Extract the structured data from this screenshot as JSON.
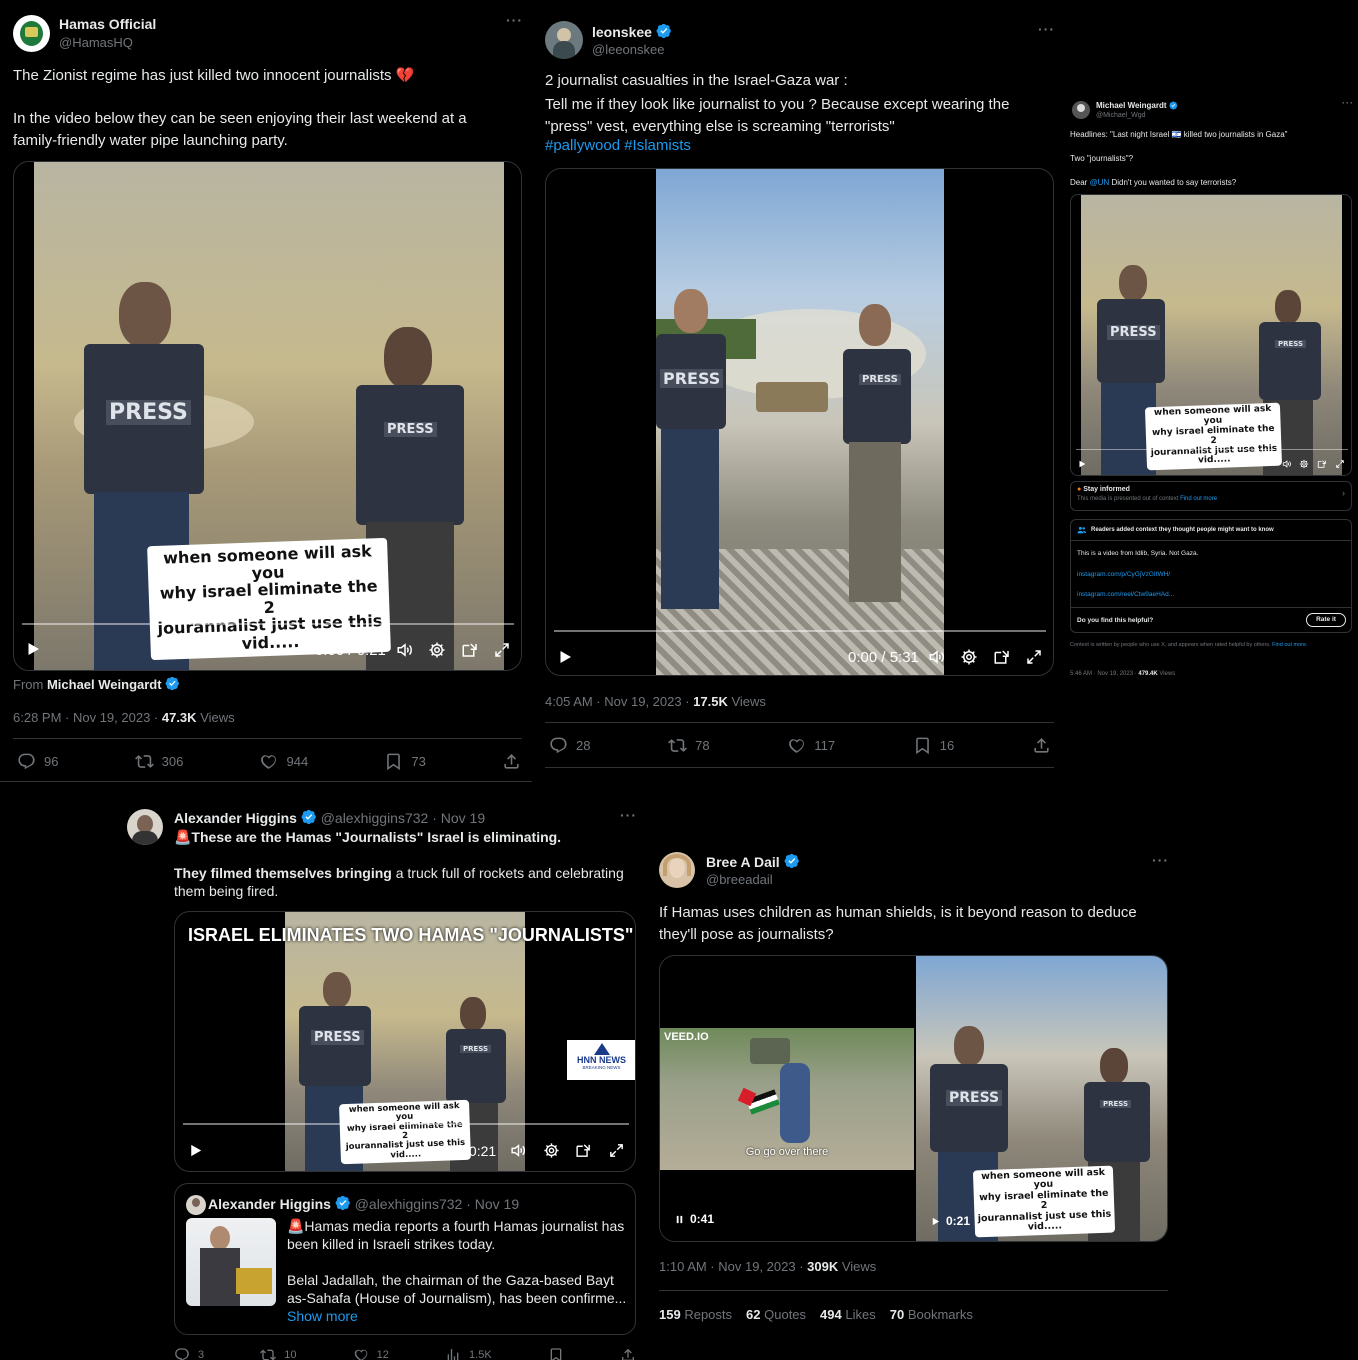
{
  "tweet1": {
    "name": "Hamas Official",
    "handle": "@HamasHQ",
    "text_line1": "The Zionist regime has just killed two innocent journalists 💔",
    "text_line2": "In the video below they can be seen enjoying their last weekend at a family-friendly water pipe launching party.",
    "video_time": "0:00 / 0:21",
    "from_label": "From",
    "from_name": "Michael Weingardt",
    "timestamp": "6:28 PM · Nov 19, 2023 · ",
    "views_count": "47.3K",
    "views_label": "Views",
    "replies": "96",
    "reposts": "306",
    "likes": "944",
    "bookmarks": "73"
  },
  "tweet2": {
    "name": "leonskee",
    "handle": "@leeonskee",
    "text_line1": "2 journalist casualties in the Israel-Gaza war :",
    "text_line2": "Tell me if they look like journalist to you ? Because except wearing the \"press\" vest, everything else is screaming \"terrorists\"",
    "hashtags": "#pallywood #Islamists",
    "video_time": "0:00 / 5:31",
    "timestamp": "4:05 AM · Nov 19, 2023 · ",
    "views_count": "17.5K",
    "views_label": "Views",
    "replies": "28",
    "reposts": "78",
    "likes": "117",
    "bookmarks": "16"
  },
  "tweet3": {
    "name": "Michael Weingardt",
    "handle": "@Michael_Wgd",
    "line1": "Headlines: \"Last night Israel 🇮🇱 killed two journalists in Gaza\"",
    "line2": "Two \"journalists\"?",
    "line3_pre": "Dear ",
    "line3_mention": "@UN",
    "line3_post": " Didn't you wanted to say terrorists?",
    "video_time": "0:01 / 0:21",
    "stay_title": "Stay informed",
    "stay_text": "This media is presented out of context ",
    "stay_link": "Find out more",
    "notes_title": "Readers added context they thought people might want to know",
    "notes_text": "This is a video from Idlib, Syria. Not Gaza.",
    "notes_link1": "instagram.com/p/CyGjVzGItWH/",
    "notes_link2": "instagram.com/reel/Ctw9aeHAd...",
    "helpful_q": "Do you find this helpful?",
    "rate_it": "Rate it",
    "footer_text": "Context is written by people who use X, and appears when rated helpful by others. ",
    "footer_link": "Find out more.",
    "timestamp": "5:46 AM · Nov 19, 2023 · ",
    "views_count": "479.4K",
    "views_label": "Views"
  },
  "tweet4": {
    "name": "Alexander Higgins",
    "handle": "@alexhiggins732 · Nov 19",
    "line1": "🚨These are the Hamas \"Journalists\" Israel is eliminating.",
    "line2_bold": "They filmed themselves bringing",
    "line2_rest": " a truck full of rockets and celebrating them being fired.",
    "banner": "ISRAEL ELIMINATES TWO HAMAS \"JOURNALISTS\"",
    "logo_text": "HNN NEWS",
    "logo_sub": "BREAKING NEWS",
    "video_time": "0:00 / 0:21",
    "quote_name": "Alexander Higgins",
    "quote_handle": "@alexhiggins732 · Nov 19",
    "quote_line1": "🚨Hamas media reports a fourth Hamas journalist has been killed in Israeli strikes today.",
    "quote_line2": "Belal Jadallah, the chairman of the Gaza-based Bayt as-Sahafa (House of Journalism), has been confirme...",
    "show_more": "Show more",
    "replies": "3",
    "reposts": "10",
    "likes": "12",
    "views": "1.5K"
  },
  "tweet5": {
    "name": "Bree A Dail",
    "handle": "@breeadail",
    "text": "If Hamas uses children as human shields, is it beyond reason to deduce they'll pose as journalists?",
    "veed_label": "VEED.IO",
    "left_subtitle": "Go go over there",
    "left_time": "0:41",
    "right_time": "0:21",
    "timestamp": "1:10 AM · Nov 19, 2023 · ",
    "views_count": "309K",
    "views_label": "Views",
    "reposts_count": "159",
    "reposts_label": "Reposts",
    "quotes_count": "62",
    "quotes_label": "Quotes",
    "likes_count": "494",
    "likes_label": "Likes",
    "bookmarks_count": "70",
    "bookmarks_label": "Bookmarks"
  },
  "video_caption": {
    "line1": "when someone will ask you",
    "line2": "why israel eliminate the 2",
    "line3": "jourannalist just use this",
    "line4": "vid....."
  },
  "press_text": "PRESS",
  "colors": {
    "accent": "#1d9bf0",
    "background": "#000000",
    "muted": "#71767b",
    "note_orange": "#ff7a00"
  }
}
